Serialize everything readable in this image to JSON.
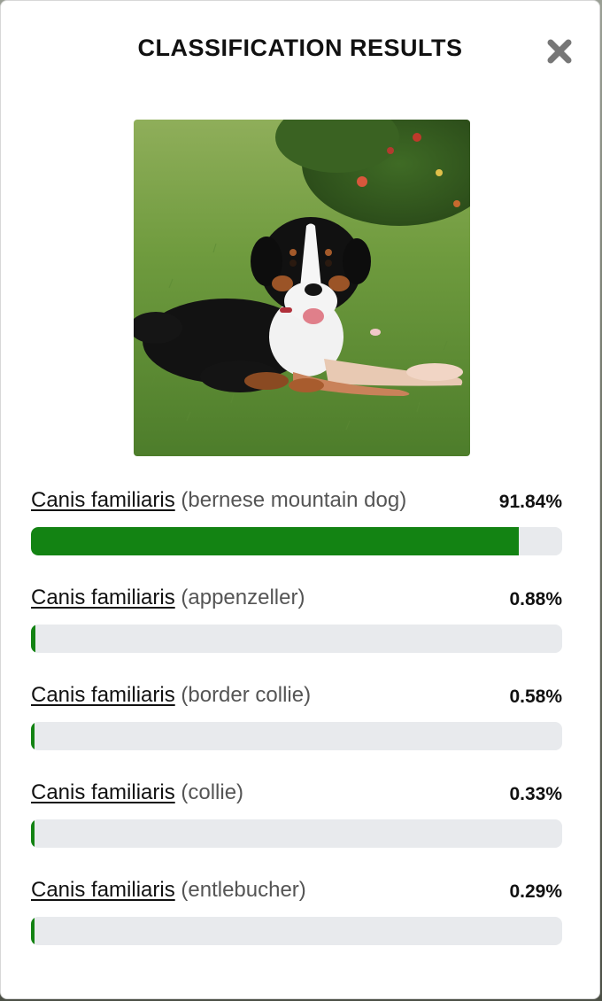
{
  "modal": {
    "title": "CLASSIFICATION RESULTS",
    "close_icon": "close-x-icon"
  },
  "image": {
    "subject": "bernese-mountain-dog-photo"
  },
  "colors": {
    "bar_fill": "#138313",
    "bar_track": "#e8eaed"
  },
  "results": [
    {
      "genus": "Canis familiaris",
      "common": "(bernese mountain dog)",
      "percent_label": "91.84%",
      "value": 91.84
    },
    {
      "genus": "Canis familiaris",
      "common": "(appenzeller)",
      "percent_label": "0.88%",
      "value": 0.88
    },
    {
      "genus": "Canis familiaris",
      "common": "(border collie)",
      "percent_label": "0.58%",
      "value": 0.58
    },
    {
      "genus": "Canis familiaris",
      "common": "(collie)",
      "percent_label": "0.33%",
      "value": 0.33
    },
    {
      "genus": "Canis familiaris",
      "common": "(entlebucher)",
      "percent_label": "0.29%",
      "value": 0.29
    }
  ]
}
